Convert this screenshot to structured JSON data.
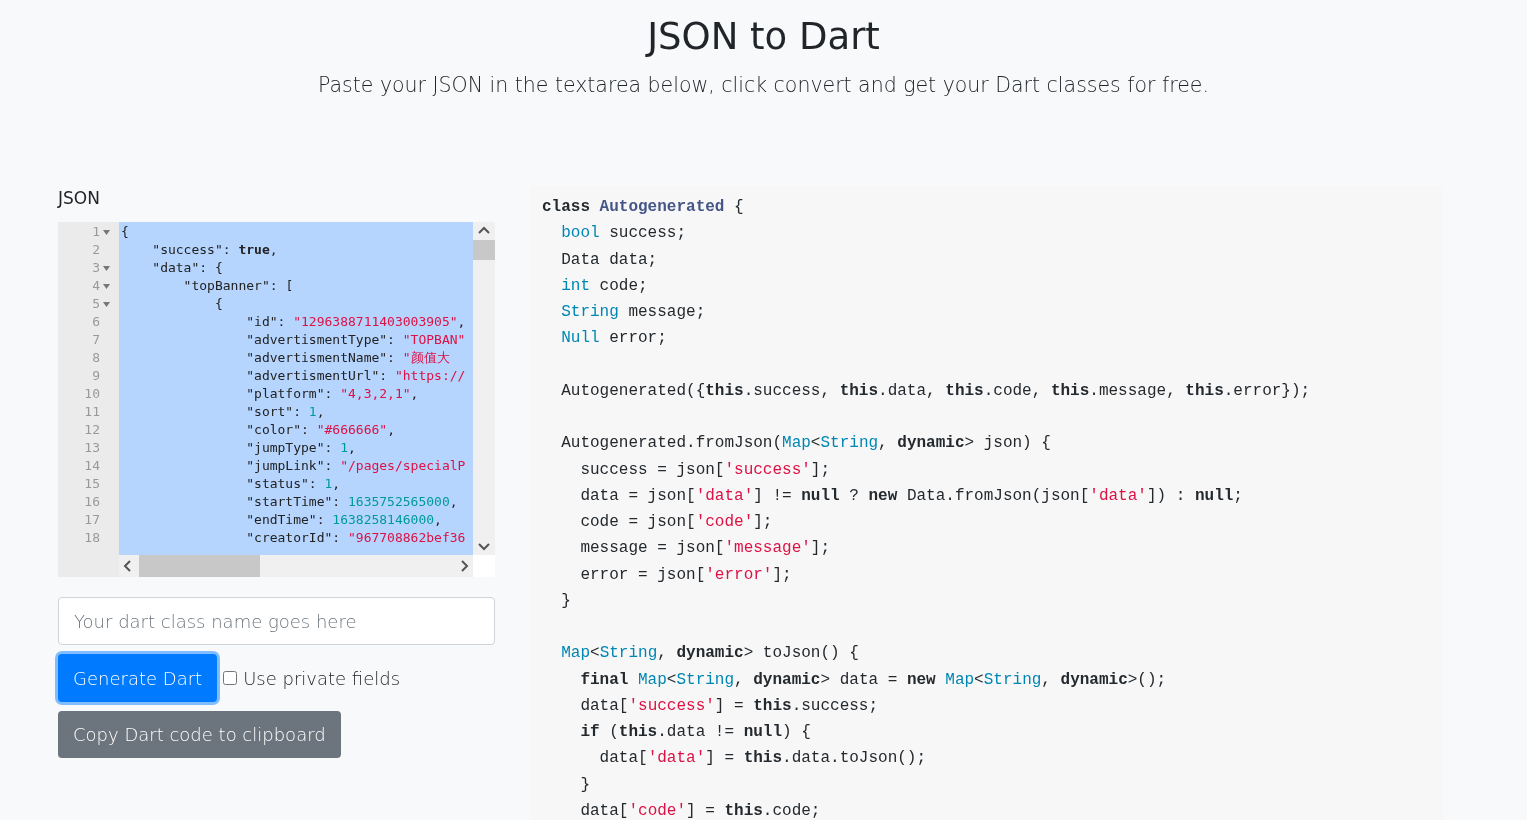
{
  "header": {
    "title": "JSON to Dart",
    "subtitle": "Paste your JSON in the textarea below, click convert and get your Dart classes for free."
  },
  "json_panel": {
    "label": "JSON",
    "text_selected": true,
    "lines": [
      {
        "number": "1",
        "fold": true,
        "tokens": [
          {
            "kind": "punct",
            "text": "{"
          }
        ]
      },
      {
        "number": "2",
        "fold": false,
        "tokens": [
          {
            "kind": "plain",
            "text": "    \"success\": "
          },
          {
            "kind": "bool",
            "text": "true"
          },
          {
            "kind": "plain",
            "text": ","
          }
        ]
      },
      {
        "number": "3",
        "fold": true,
        "tokens": [
          {
            "kind": "plain",
            "text": "    \"data\": "
          },
          {
            "kind": "punct",
            "text": "{"
          }
        ]
      },
      {
        "number": "4",
        "fold": true,
        "tokens": [
          {
            "kind": "plain",
            "text": "        \"topBanner\": "
          },
          {
            "kind": "punct",
            "text": "["
          }
        ]
      },
      {
        "number": "5",
        "fold": true,
        "tokens": [
          {
            "kind": "punct",
            "text": "            {"
          }
        ]
      },
      {
        "number": "6",
        "fold": false,
        "tokens": [
          {
            "kind": "plain",
            "text": "                \"id\": "
          },
          {
            "kind": "string",
            "text": "\"1296388711403003905\""
          },
          {
            "kind": "plain",
            "text": ","
          }
        ]
      },
      {
        "number": "7",
        "fold": false,
        "tokens": [
          {
            "kind": "plain",
            "text": "                \"advertismentType\": "
          },
          {
            "kind": "string",
            "text": "\"TOPBAN\""
          }
        ]
      },
      {
        "number": "8",
        "fold": false,
        "tokens": [
          {
            "kind": "plain",
            "text": "                \"advertismentName\": "
          },
          {
            "kind": "string",
            "text": "\"颜值大"
          }
        ]
      },
      {
        "number": "9",
        "fold": false,
        "tokens": [
          {
            "kind": "plain",
            "text": "                \"advertismentUrl\": "
          },
          {
            "kind": "string",
            "text": "\"https://"
          }
        ]
      },
      {
        "number": "10",
        "fold": false,
        "tokens": [
          {
            "kind": "plain",
            "text": "                \"platform\": "
          },
          {
            "kind": "string",
            "text": "\"4,3,2,1\""
          },
          {
            "kind": "plain",
            "text": ","
          }
        ]
      },
      {
        "number": "11",
        "fold": false,
        "tokens": [
          {
            "kind": "plain",
            "text": "                \"sort\": "
          },
          {
            "kind": "number",
            "text": "1"
          },
          {
            "kind": "plain",
            "text": ","
          }
        ]
      },
      {
        "number": "12",
        "fold": false,
        "tokens": [
          {
            "kind": "plain",
            "text": "                \"color\": "
          },
          {
            "kind": "string",
            "text": "\"#666666\""
          },
          {
            "kind": "plain",
            "text": ","
          }
        ]
      },
      {
        "number": "13",
        "fold": false,
        "tokens": [
          {
            "kind": "plain",
            "text": "                \"jumpType\": "
          },
          {
            "kind": "number",
            "text": "1"
          },
          {
            "kind": "plain",
            "text": ","
          }
        ]
      },
      {
        "number": "14",
        "fold": false,
        "tokens": [
          {
            "kind": "plain",
            "text": "                \"jumpLink\": "
          },
          {
            "kind": "string",
            "text": "\"/pages/specialP"
          }
        ]
      },
      {
        "number": "15",
        "fold": false,
        "tokens": [
          {
            "kind": "plain",
            "text": "                \"status\": "
          },
          {
            "kind": "number",
            "text": "1"
          },
          {
            "kind": "plain",
            "text": ","
          }
        ]
      },
      {
        "number": "16",
        "fold": false,
        "tokens": [
          {
            "kind": "plain",
            "text": "                \"startTime\": "
          },
          {
            "kind": "number",
            "text": "1635752565000"
          },
          {
            "kind": "plain",
            "text": ","
          }
        ]
      },
      {
        "number": "17",
        "fold": false,
        "tokens": [
          {
            "kind": "plain",
            "text": "                \"endTime\": "
          },
          {
            "kind": "number",
            "text": "1638258146000"
          },
          {
            "kind": "plain",
            "text": ","
          }
        ]
      },
      {
        "number": "18",
        "fold": false,
        "tokens": [
          {
            "kind": "plain",
            "text": "                \"creatorId\": "
          },
          {
            "kind": "string",
            "text": "\"967708862bef36"
          }
        ]
      }
    ]
  },
  "class_name_field": {
    "placeholder": "Your dart class name goes here"
  },
  "generate_button": {
    "label": "Generate Dart"
  },
  "private_fields": {
    "label": "Use private fields",
    "checked": false
  },
  "copy_button": {
    "label": "Copy Dart code to clipboard"
  },
  "dart_output": {
    "lines": [
      {
        "kind": "code",
        "tokens": [
          {
            "kind": "keyword",
            "text": "class "
          },
          {
            "kind": "title",
            "text": "Autogenerated"
          },
          {
            "kind": "plain",
            "text": " {"
          }
        ]
      },
      {
        "kind": "code",
        "tokens": [
          {
            "kind": "type",
            "text": "  bool"
          },
          {
            "kind": "plain",
            "text": " success;"
          }
        ]
      },
      {
        "kind": "code",
        "tokens": [
          {
            "kind": "plain",
            "text": "  Data data;"
          }
        ]
      },
      {
        "kind": "code",
        "tokens": [
          {
            "kind": "type",
            "text": "  int"
          },
          {
            "kind": "plain",
            "text": " code;"
          }
        ]
      },
      {
        "kind": "code",
        "tokens": [
          {
            "kind": "type",
            "text": "  String"
          },
          {
            "kind": "plain",
            "text": " message;"
          }
        ]
      },
      {
        "kind": "code",
        "tokens": [
          {
            "kind": "type",
            "text": "  Null"
          },
          {
            "kind": "plain",
            "text": " error;"
          }
        ]
      },
      {
        "kind": "blank"
      },
      {
        "kind": "code",
        "tokens": [
          {
            "kind": "plain",
            "text": "  Autogenerated({"
          },
          {
            "kind": "keyword",
            "text": "this"
          },
          {
            "kind": "plain",
            "text": ".success, "
          },
          {
            "kind": "keyword",
            "text": "this"
          },
          {
            "kind": "plain",
            "text": ".data, "
          },
          {
            "kind": "keyword",
            "text": "this"
          },
          {
            "kind": "plain",
            "text": ".code, "
          },
          {
            "kind": "keyword",
            "text": "this"
          },
          {
            "kind": "plain",
            "text": ".message, "
          },
          {
            "kind": "keyword",
            "text": "this"
          },
          {
            "kind": "plain",
            "text": ".error});"
          }
        ]
      },
      {
        "kind": "blank"
      },
      {
        "kind": "code",
        "tokens": [
          {
            "kind": "plain",
            "text": "  Autogenerated.fromJson("
          },
          {
            "kind": "type",
            "text": "Map"
          },
          {
            "kind": "plain",
            "text": "<"
          },
          {
            "kind": "type",
            "text": "String"
          },
          {
            "kind": "plain",
            "text": ", "
          },
          {
            "kind": "keyword",
            "text": "dynamic"
          },
          {
            "kind": "plain",
            "text": "> json) {"
          }
        ]
      },
      {
        "kind": "code",
        "tokens": [
          {
            "kind": "plain",
            "text": "    success = json["
          },
          {
            "kind": "string",
            "text": "'success'"
          },
          {
            "kind": "plain",
            "text": "];"
          }
        ]
      },
      {
        "kind": "code",
        "tokens": [
          {
            "kind": "plain",
            "text": "    data = json["
          },
          {
            "kind": "string",
            "text": "'data'"
          },
          {
            "kind": "plain",
            "text": "] != "
          },
          {
            "kind": "keyword",
            "text": "null"
          },
          {
            "kind": "plain",
            "text": " ? "
          },
          {
            "kind": "keyword",
            "text": "new"
          },
          {
            "kind": "plain",
            "text": " Data.fromJson(json["
          },
          {
            "kind": "string",
            "text": "'data'"
          },
          {
            "kind": "plain",
            "text": "]) : "
          },
          {
            "kind": "keyword",
            "text": "null"
          },
          {
            "kind": "plain",
            "text": ";"
          }
        ]
      },
      {
        "kind": "code",
        "tokens": [
          {
            "kind": "plain",
            "text": "    code = json["
          },
          {
            "kind": "string",
            "text": "'code'"
          },
          {
            "kind": "plain",
            "text": "];"
          }
        ]
      },
      {
        "kind": "code",
        "tokens": [
          {
            "kind": "plain",
            "text": "    message = json["
          },
          {
            "kind": "string",
            "text": "'message'"
          },
          {
            "kind": "plain",
            "text": "];"
          }
        ]
      },
      {
        "kind": "code",
        "tokens": [
          {
            "kind": "plain",
            "text": "    error = json["
          },
          {
            "kind": "string",
            "text": "'error'"
          },
          {
            "kind": "plain",
            "text": "];"
          }
        ]
      },
      {
        "kind": "code",
        "tokens": [
          {
            "kind": "plain",
            "text": "  }"
          }
        ]
      },
      {
        "kind": "blank"
      },
      {
        "kind": "code",
        "tokens": [
          {
            "kind": "type",
            "text": "  Map"
          },
          {
            "kind": "plain",
            "text": "<"
          },
          {
            "kind": "type",
            "text": "String"
          },
          {
            "kind": "plain",
            "text": ", "
          },
          {
            "kind": "keyword",
            "text": "dynamic"
          },
          {
            "kind": "plain",
            "text": "> toJson() {"
          }
        ]
      },
      {
        "kind": "code",
        "tokens": [
          {
            "kind": "keyword",
            "text": "    final "
          },
          {
            "kind": "type",
            "text": "Map"
          },
          {
            "kind": "plain",
            "text": "<"
          },
          {
            "kind": "type",
            "text": "String"
          },
          {
            "kind": "plain",
            "text": ", "
          },
          {
            "kind": "keyword",
            "text": "dynamic"
          },
          {
            "kind": "plain",
            "text": "> data = "
          },
          {
            "kind": "keyword",
            "text": "new "
          },
          {
            "kind": "type",
            "text": "Map"
          },
          {
            "kind": "plain",
            "text": "<"
          },
          {
            "kind": "type",
            "text": "String"
          },
          {
            "kind": "plain",
            "text": ", "
          },
          {
            "kind": "keyword",
            "text": "dynamic"
          },
          {
            "kind": "plain",
            "text": ">();"
          }
        ]
      },
      {
        "kind": "code",
        "tokens": [
          {
            "kind": "plain",
            "text": "    data["
          },
          {
            "kind": "string",
            "text": "'success'"
          },
          {
            "kind": "plain",
            "text": "] = "
          },
          {
            "kind": "keyword",
            "text": "this"
          },
          {
            "kind": "plain",
            "text": ".success;"
          }
        ]
      },
      {
        "kind": "code",
        "tokens": [
          {
            "kind": "keyword",
            "text": "    if"
          },
          {
            "kind": "plain",
            "text": " ("
          },
          {
            "kind": "keyword",
            "text": "this"
          },
          {
            "kind": "plain",
            "text": ".data != "
          },
          {
            "kind": "keyword",
            "text": "null"
          },
          {
            "kind": "plain",
            "text": ") {"
          }
        ]
      },
      {
        "kind": "code",
        "tokens": [
          {
            "kind": "plain",
            "text": "      data["
          },
          {
            "kind": "string",
            "text": "'data'"
          },
          {
            "kind": "plain",
            "text": "] = "
          },
          {
            "kind": "keyword",
            "text": "this"
          },
          {
            "kind": "plain",
            "text": ".data.toJson();"
          }
        ]
      },
      {
        "kind": "code",
        "tokens": [
          {
            "kind": "plain",
            "text": "    }"
          }
        ]
      },
      {
        "kind": "code",
        "tokens": [
          {
            "kind": "plain",
            "text": "    data["
          },
          {
            "kind": "string",
            "text": "'code'"
          },
          {
            "kind": "plain",
            "text": "] = "
          },
          {
            "kind": "keyword",
            "text": "this"
          },
          {
            "kind": "plain",
            "text": ".code;"
          }
        ]
      }
    ]
  }
}
